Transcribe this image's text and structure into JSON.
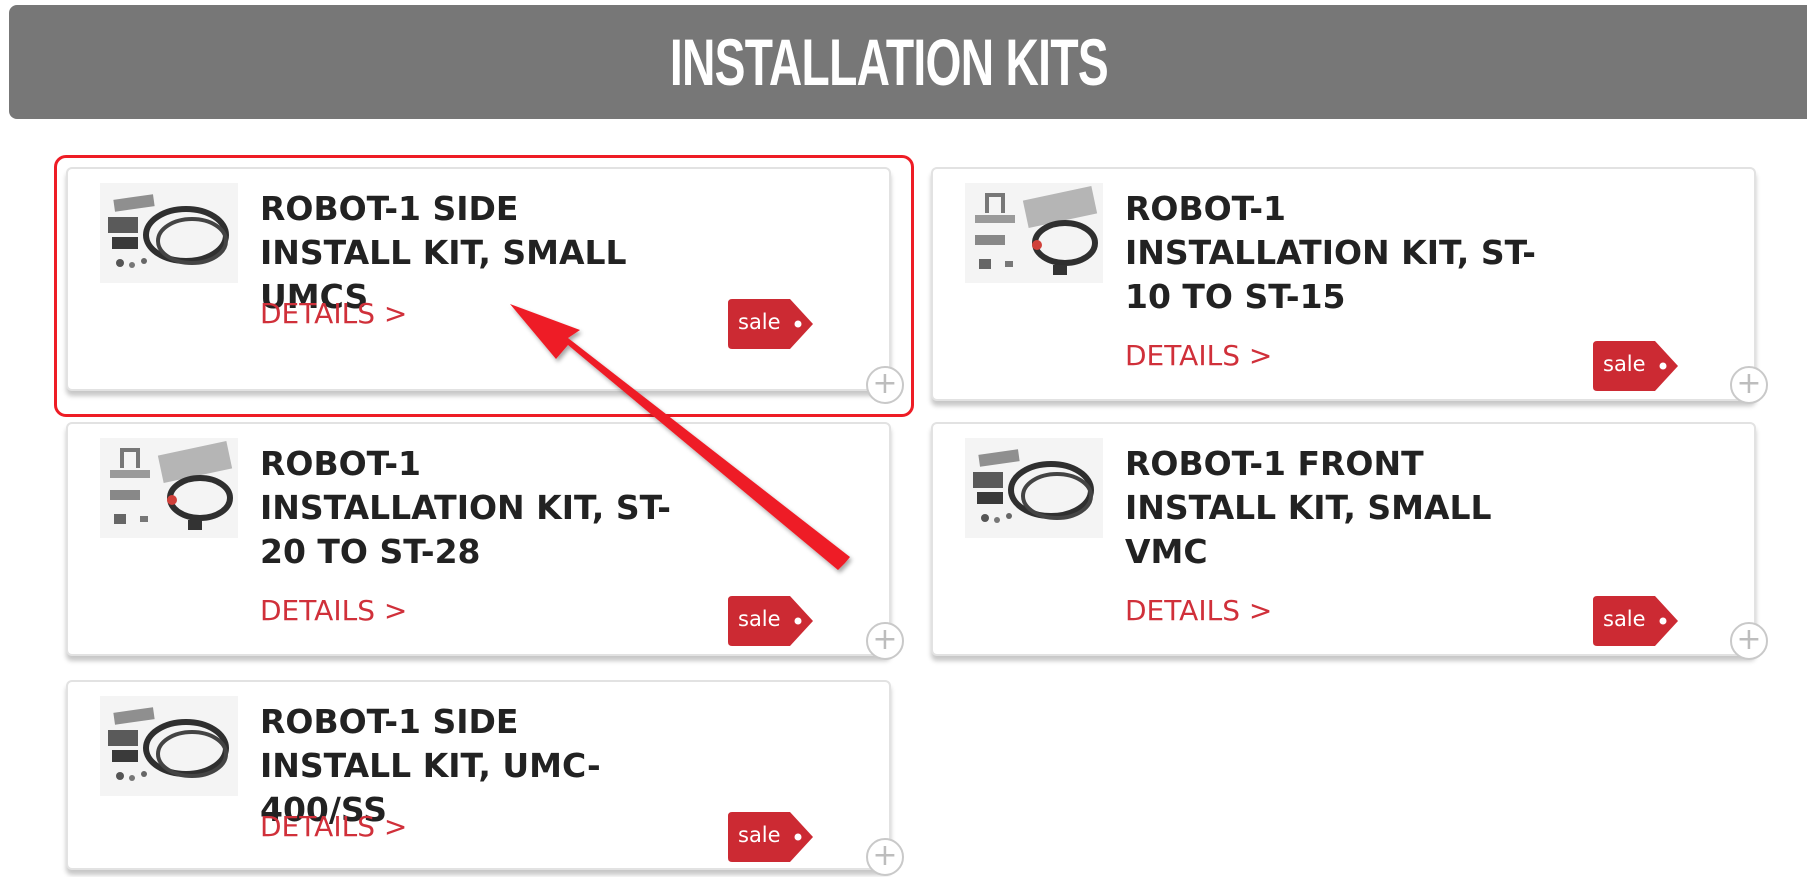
{
  "header": {
    "title": "INSTALLATION KITS"
  },
  "products": [
    {
      "title": "ROBOT-1 SIDE INSTALL KIT, SMALL UMCS",
      "details_label": "DETAILS >",
      "sale_label": "sale",
      "thumbnail": "kit-cables-thumbnail"
    },
    {
      "title": "ROBOT-1 INSTALLATION KIT, ST-10 TO ST-15",
      "details_label": "DETAILS >",
      "sale_label": "sale",
      "thumbnail": "kit-brackets-thumbnail"
    },
    {
      "title": "ROBOT-1 INSTALLATION KIT, ST-20 TO ST-28",
      "details_label": "DETAILS >",
      "sale_label": "sale",
      "thumbnail": "kit-brackets-thumbnail"
    },
    {
      "title": "ROBOT-1 FRONT INSTALL KIT, SMALL VMC",
      "details_label": "DETAILS >",
      "sale_label": "sale",
      "thumbnail": "kit-cables-thumbnail"
    },
    {
      "title": "ROBOT-1 SIDE INSTALL KIT, UMC-400/SS",
      "details_label": "DETAILS >",
      "sale_label": "sale",
      "thumbnail": "kit-cables-thumbnail"
    }
  ],
  "colors": {
    "header_bg": "#777777",
    "accent_red": "#d0303a",
    "sale_tag": "#cc2a33",
    "highlight": "#ee1c25"
  },
  "icons": {
    "plus": "plus-circle-icon",
    "sale": "sale-tag-icon",
    "annotation": "red-arrow-annotation"
  }
}
